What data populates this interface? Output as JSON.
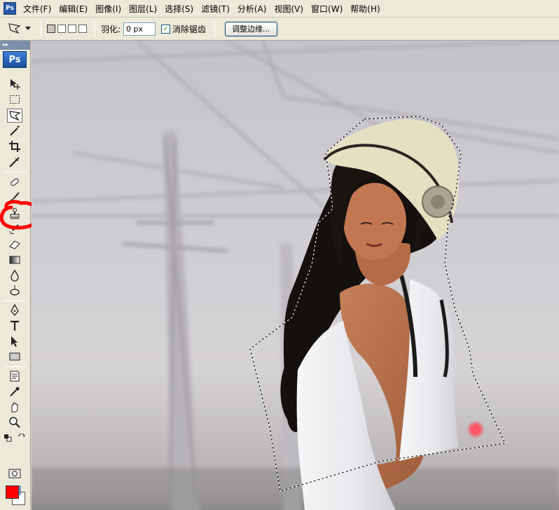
{
  "menubar": {
    "app_icon": "photoshop-icon",
    "items": [
      "文件(F)",
      "编辑(E)",
      "图像(I)",
      "图层(L)",
      "选择(S)",
      "滤镜(T)",
      "分析(A)",
      "视图(V)",
      "窗口(W)",
      "帮助(H)"
    ]
  },
  "options": {
    "tool_preset_icon": "polygonal-lasso-icon",
    "selection_modes": [
      "new-selection",
      "add-to-selection",
      "subtract-from-selection",
      "intersect-with-selection"
    ],
    "active_selection_mode": "new-selection",
    "feather_label": "羽化:",
    "feather_value": "0 px",
    "antialias_label": "消除锯齿",
    "antialias_checked": true,
    "refine_edge_label": "调整边缘..."
  },
  "toolbox": {
    "badge": "Ps",
    "tools": [
      "move",
      "rectangular-marquee",
      "polygonal-lasso",
      "magic-wand",
      "crop",
      "slice",
      "spot-healing-brush",
      "brush",
      "clone-stamp",
      "history-brush",
      "eraser",
      "gradient",
      "blur",
      "dodge",
      "pen",
      "type",
      "path-selection",
      "rectangle",
      "notes",
      "eyedropper",
      "hand",
      "zoom"
    ],
    "selected_tool": "polygonal-lasso",
    "highlighted_tool": "clone-stamp",
    "foreground_color": "#ff0000",
    "background_color": "#ffffff"
  },
  "annotation": {
    "color": "#ff0000",
    "shape": "hand-drawn-circle"
  }
}
